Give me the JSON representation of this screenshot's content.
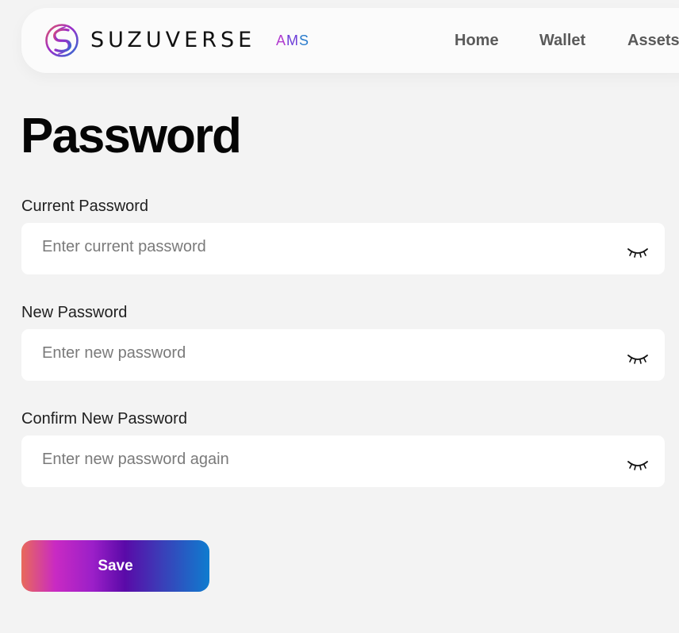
{
  "header": {
    "brand_name": "SUZUVERSE",
    "brand_suffix": [
      "A",
      "M",
      "S"
    ],
    "nav": [
      "Home",
      "Wallet",
      "Assets"
    ]
  },
  "page": {
    "title": "Password"
  },
  "form": {
    "fields": [
      {
        "label": "Current Password",
        "placeholder": "Enter current password",
        "value": ""
      },
      {
        "label": "New Password",
        "placeholder": "Enter new password",
        "value": ""
      },
      {
        "label": "Confirm New Password",
        "placeholder": "Enter new password again",
        "value": ""
      }
    ],
    "eye_icon": "eye-closed-icon",
    "save_label": "Save"
  },
  "colors": {
    "background": "#f3f3f3",
    "header_bg": "#fbfbfb",
    "gradient": [
      "#e86a5a",
      "#c92ac3",
      "#5a0aa8",
      "#0f7ccf"
    ],
    "brand_suffix_colors": [
      "#b23ccf",
      "#6d3dd8",
      "#2a7ccc"
    ]
  }
}
